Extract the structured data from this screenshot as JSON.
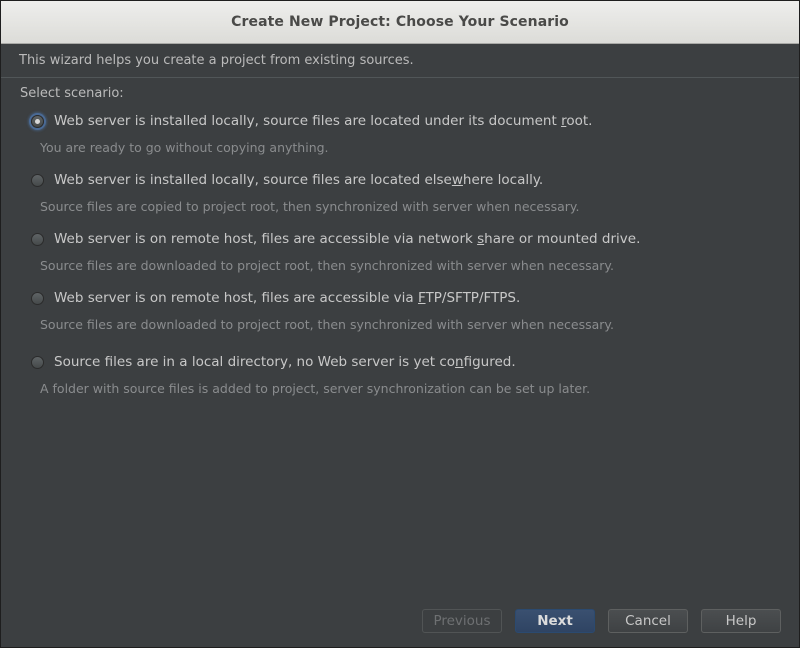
{
  "window": {
    "title": "Create New Project: Choose Your Scenario"
  },
  "intro": "This wizard helps you create a project from existing sources.",
  "select_label": "Select scenario:",
  "scenarios": [
    {
      "selected": true,
      "label_parts": [
        "Web server is installed locally, source files are located under its document ",
        "r",
        "oot."
      ],
      "description": "You are ready to go without copying anything."
    },
    {
      "selected": false,
      "label_parts": [
        "Web server is installed locally, source files are located else",
        "w",
        "here locally."
      ],
      "description": "Source files are copied to project root, then synchronized with server when necessary."
    },
    {
      "selected": false,
      "label_parts": [
        "Web server is on remote host, files are accessible via network ",
        "s",
        "hare or mounted drive."
      ],
      "description": "Source files are downloaded to project root, then synchronized with server when necessary."
    },
    {
      "selected": false,
      "label_parts": [
        "Web server is on remote host, files are accessible via ",
        "F",
        "TP/SFTP/FTPS."
      ],
      "description": "Source files are downloaded to project root, then synchronized with server when necessary."
    },
    {
      "selected": false,
      "label_parts": [
        "Source files are in a local directory, no Web server is yet co",
        "n",
        "figured."
      ],
      "description": "A folder with source files is added to project, server synchronization can be set up later."
    }
  ],
  "buttons": {
    "previous": "Previous",
    "next": "Next",
    "cancel": "Cancel",
    "help": "Help"
  }
}
